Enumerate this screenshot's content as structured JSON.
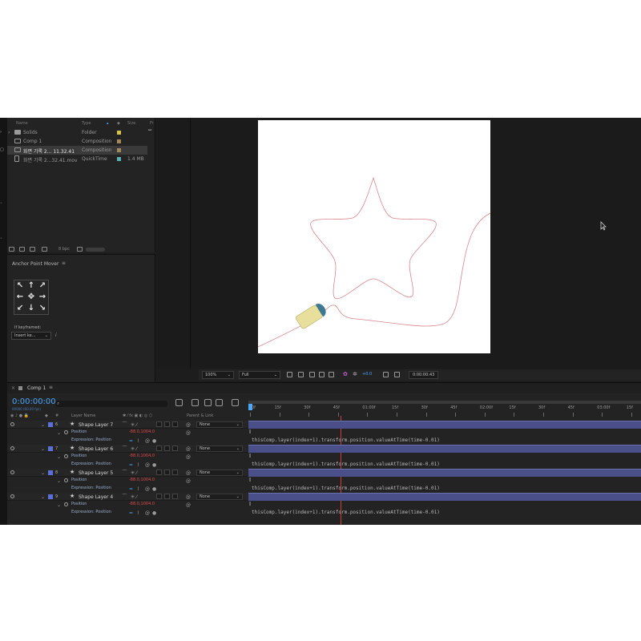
{
  "project": {
    "columns": [
      "Name",
      "Type",
      "Size",
      "Fr"
    ],
    "items": [
      {
        "name": "Solids",
        "type": "Folder",
        "size": "",
        "swatch": "#d6c24a",
        "kind": "folder"
      },
      {
        "name": "Comp 1",
        "type": "Composition",
        "size": "",
        "swatch": "#a08a5a",
        "kind": "comp"
      },
      {
        "name": "화면 기록 2... 11.32.41",
        "type": "Composition",
        "size": "",
        "swatch": "#a08a5a",
        "kind": "comp",
        "selected": true
      },
      {
        "name": "화면 기록 2...32.41.mov",
        "type": "QuickTime",
        "size": "1.4 MB",
        "swatch": "#5ab0b0",
        "kind": "file"
      }
    ],
    "bpc": "8 bpc"
  },
  "anchor_panel": {
    "title": "Anchor Point Mover",
    "menu_icon": "≡",
    "arrows": [
      "↖",
      "↑",
      "↗",
      "←",
      "✥",
      "→",
      "↙",
      "↓",
      "↘"
    ],
    "keyframed_label": "If keyframed:",
    "keyframe_option": "Insert ke...",
    "info": "i"
  },
  "viewer": {
    "zoom": "100%",
    "resolution": "Full",
    "exposure": "+0.0",
    "time": "0:00:00:43"
  },
  "timeline": {
    "comp_name": "Comp 1",
    "menu_icon": "≡",
    "close_icon": "×",
    "timecode": "0:00:00:00",
    "frames_sub": "00000 (60.00 fps)",
    "search_placeholder": "",
    "col_layer_name": "Layer Name",
    "col_parent": "Parent & Link",
    "col_hash": "#",
    "ruler_ticks": [
      "0f",
      "15f",
      "30f",
      "45f",
      "01:00f",
      "15f",
      "30f",
      "45f",
      "02:00f",
      "15f",
      "30f",
      "45f",
      "03:00f",
      "15f"
    ],
    "layers": [
      {
        "num": "6",
        "name": "Shape Layer 7",
        "position_label": "Position",
        "position_value": "-88.0,1004.0",
        "expression_label": "Expression: Position",
        "parent": "None"
      },
      {
        "num": "7",
        "name": "Shape Layer 6",
        "position_label": "Position",
        "position_value": "-88.0,1004.0",
        "expression_label": "Expression: Position",
        "parent": "None"
      },
      {
        "num": "8",
        "name": "Shape Layer 5",
        "position_label": "Position",
        "position_value": "-88.0,1004.0",
        "expression_label": "Expression: Position",
        "parent": "None"
      },
      {
        "num": "9",
        "name": "Shape Layer 4",
        "position_label": "Position",
        "position_value": "-88.0,1004.0",
        "expression_label": "Expression: Position",
        "parent": "None"
      }
    ],
    "expression_text": "thisComp.layer(index+1).transform.position.valueAtTime(time-0.01)"
  },
  "colors": {
    "accent_blue": "#4aa8ff",
    "layer_label": "#5b6fd6",
    "keyframe_value": "#e04848",
    "path_stroke": "#d9868c",
    "shape_fill": "#e9df9c",
    "shape_accent": "#3c7a93"
  }
}
